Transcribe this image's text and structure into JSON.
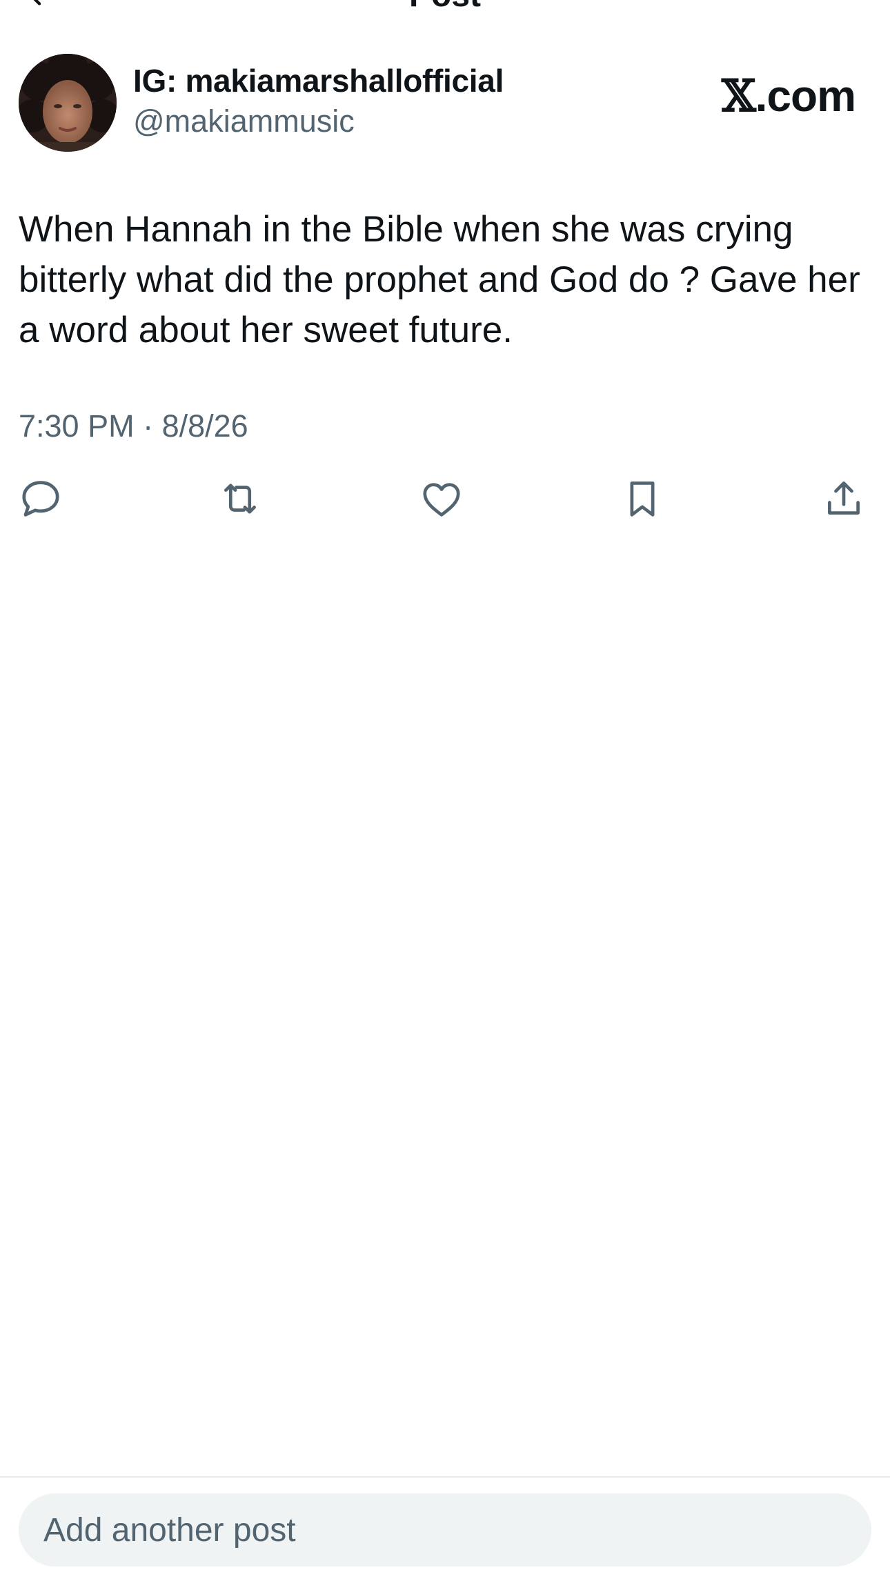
{
  "header": {
    "title": "Post",
    "back_icon": "back-arrow-icon"
  },
  "post": {
    "author": {
      "display_name": "IG: makiamarshallofficial",
      "handle": "@makiammusic"
    },
    "brand": {
      "x_mark": "𝕏",
      "suffix": ".com"
    },
    "text": "When Hannah in the Bible when she was crying bitterly what did the prophet and God do ? Gave her a word about her sweet future.",
    "timestamp": "7:30 PM · 8/8/26",
    "actions": [
      "reply-icon",
      "repost-icon",
      "like-icon",
      "bookmark-icon",
      "share-icon"
    ]
  },
  "compose": {
    "placeholder": "Add another post"
  },
  "colors": {
    "text": "#0f1419",
    "secondary": "#536471",
    "compose_bg": "#eff3f4",
    "divider": "#e7e9ea"
  }
}
